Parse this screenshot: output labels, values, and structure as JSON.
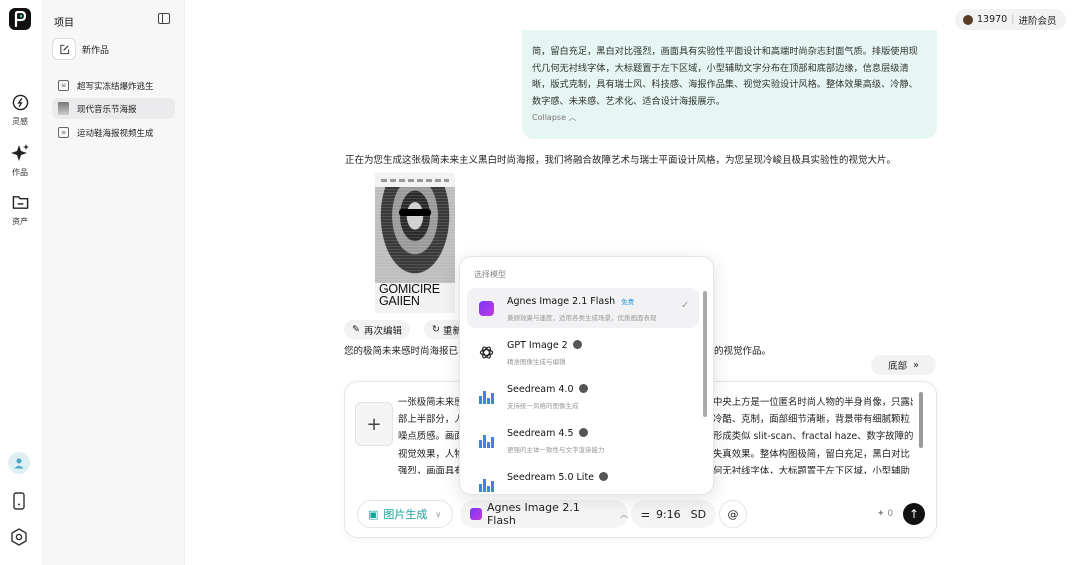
{
  "rail": {
    "inspiration": "灵感",
    "works": "作品",
    "assets": "资产"
  },
  "panel": {
    "title": "项目",
    "new_work": "新作品",
    "projects": [
      "超写实冻结爆炸逃生",
      "现代音乐节海报",
      "运动鞋海报视频生成"
    ]
  },
  "credits": {
    "amount": "13970",
    "upgrade": "进阶会员"
  },
  "bubble": {
    "text": "简，留白充足，黑白对比强烈，画面具有实验性平面设计和高端时尚杂志封面气质。排版使用现代几何无衬线字体，大标题置于左下区域，小型辅助文字分布在顶部和底部边缘，信息层级清晰，版式克制，具有瑞士风、科技感、海报作品集、视觉实验设计风格。整体效果高级、冷静、数字感、未来感、艺术化、适合设计海报展示。",
    "collapse": "Collapse"
  },
  "assistant_message": "正在为您生成这张极简未来主义黑白时尚海报，我们将融合故障艺术与瑞士平面设计风格，为您呈现冷峻且极具实验性的视觉大片。",
  "poster": {
    "title_line1": "GOMICIRE",
    "title_line2": "GAIIEN"
  },
  "actions": {
    "re_edit": "再次编辑",
    "regenerate": "重新"
  },
  "status_left": "您的极简未来感时尚海报已",
  "status_right": "的视觉作品。",
  "bottom_button": "底部",
  "composer": {
    "text_left": "一张极简未来感\n部上半部分，人\n噪点质感。画面\n视觉效果，人物\n强烈，画面具有",
    "text_right": "中央上方是一位匿名时尚人物的半身肖像，只露出头\n冷酷、克制，面部细节清晰，背景带有细腻颗粒\n形成类似 slit-scan、fractal haze、数字故障的\n失真效果。整体构图极简，留白充足，黑白对比\n何无衬线字体，大标题置于左下区域，小型辅助",
    "mode": "图片生成",
    "model": "Agnes Image 2.1 Flash",
    "ratio": "9:16",
    "quality": "SD",
    "at": "@",
    "cost": "0"
  },
  "dropdown": {
    "title": "选择模型",
    "items": [
      {
        "name": "Agnes Image 2.1 Flash",
        "tag": "免费",
        "sub": "兼顾效果与速度，适用各类生成场景，优质画面表现"
      },
      {
        "name": "GPT Image 2",
        "sub": "精准图像生成与编辑"
      },
      {
        "name": "Seedream 4.0",
        "sub": "支持统一风格的图像生成"
      },
      {
        "name": "Seedream 4.5",
        "sub": "更强的主体一致性与文字渲染能力"
      },
      {
        "name": "Seedream 5.0 Lite",
        "sub": ""
      }
    ]
  }
}
